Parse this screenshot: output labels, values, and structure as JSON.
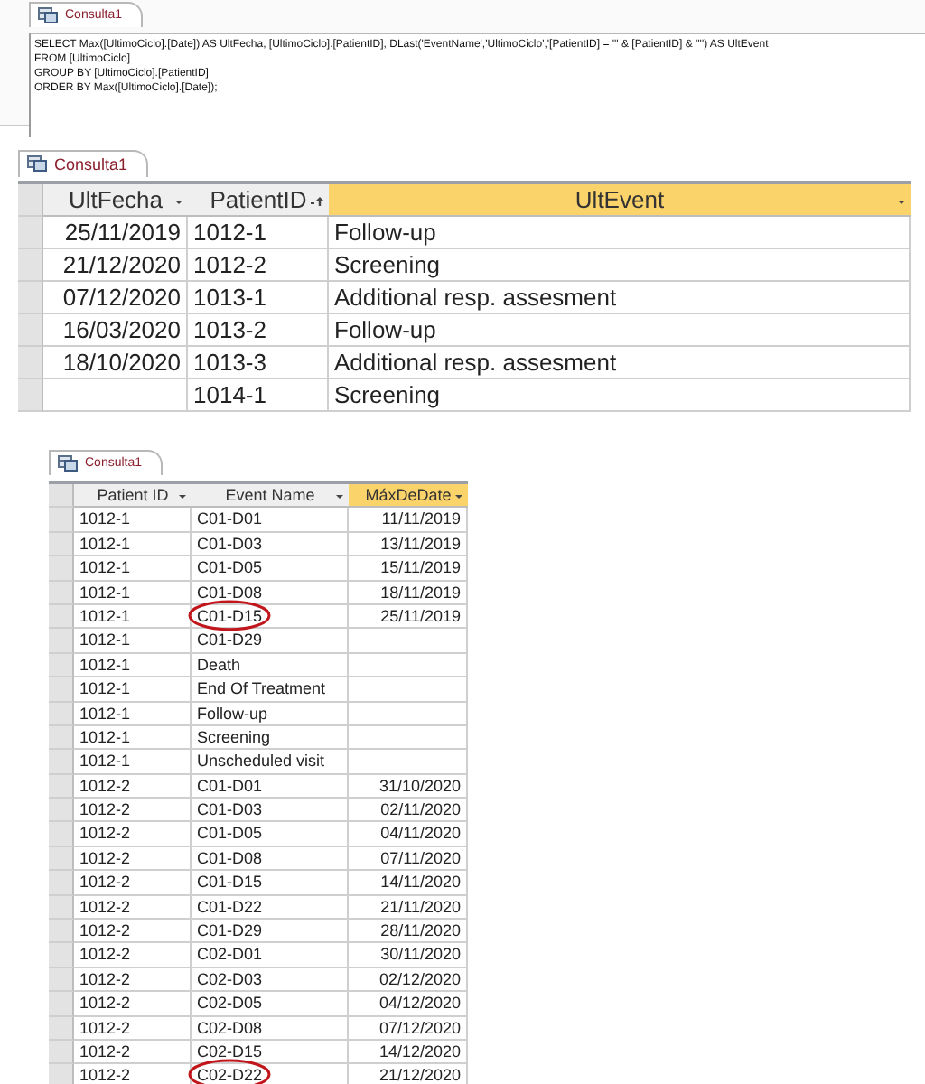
{
  "sql_view": {
    "tab": {
      "label": "Consulta1",
      "selected": true
    },
    "lines": [
      "SELECT Max([UltimoCiclo].[Date]) AS UltFecha, [UltimoCiclo].[PatientID], DLast('EventName','UltimoCiclo','[PatientID] = ''' & [PatientID] & '''') AS UltEvent",
      "FROM [UltimoCiclo]",
      "GROUP BY [UltimoCiclo].[PatientID]",
      "ORDER BY Max([UltimoCiclo].[Date]);"
    ]
  },
  "result_grid": {
    "tab": {
      "label": "Consulta1",
      "selected": true
    },
    "columns": [
      {
        "label": "UltFecha",
        "selected": false,
        "sorted": false
      },
      {
        "label": "PatientID",
        "selected": false,
        "sorted": true
      },
      {
        "label": "UltEvent",
        "selected": true,
        "sorted": false
      }
    ],
    "rows": [
      {
        "cells": [
          "25/11/2019",
          "1012-1",
          "Follow-up"
        ]
      },
      {
        "cells": [
          "21/12/2020",
          "1012-2",
          "Screening"
        ]
      },
      {
        "cells": [
          "07/12/2020",
          "1013-1",
          "Additional resp. assesment"
        ]
      },
      {
        "cells": [
          "16/03/2020",
          "1013-2",
          "Follow-up"
        ]
      },
      {
        "cells": [
          "18/10/2020",
          "1013-3",
          "Additional resp. assesment"
        ]
      },
      {
        "cells": [
          "",
          "1014-1",
          "Screening"
        ]
      }
    ]
  },
  "source_grid": {
    "tab": {
      "label": "Consulta1",
      "selected": true
    },
    "columns": [
      {
        "label": "Patient ID",
        "selected": false,
        "sorted": false
      },
      {
        "label": "Event Name",
        "selected": false,
        "sorted": false
      },
      {
        "label": "MáxDeDate",
        "selected": true,
        "sorted": false
      }
    ],
    "rows": [
      {
        "cells": [
          "1012-1",
          "C01-D01",
          "11/11/2019"
        ],
        "circled": false
      },
      {
        "cells": [
          "1012-1",
          "C01-D03",
          "13/11/2019"
        ],
        "circled": false
      },
      {
        "cells": [
          "1012-1",
          "C01-D05",
          "15/11/2019"
        ],
        "circled": false
      },
      {
        "cells": [
          "1012-1",
          "C01-D08",
          "18/11/2019"
        ],
        "circled": false
      },
      {
        "cells": [
          "1012-1",
          "C01-D15",
          "25/11/2019"
        ],
        "circled": true
      },
      {
        "cells": [
          "1012-1",
          "C01-D29",
          ""
        ],
        "circled": false
      },
      {
        "cells": [
          "1012-1",
          "Death",
          ""
        ],
        "circled": false
      },
      {
        "cells": [
          "1012-1",
          "End Of  Treatment",
          ""
        ],
        "circled": false
      },
      {
        "cells": [
          "1012-1",
          "Follow-up",
          ""
        ],
        "circled": false
      },
      {
        "cells": [
          "1012-1",
          "Screening",
          ""
        ],
        "circled": false
      },
      {
        "cells": [
          "1012-1",
          "Unscheduled visit",
          ""
        ],
        "circled": false
      },
      {
        "cells": [
          "1012-2",
          "C01-D01",
          "31/10/2020"
        ],
        "circled": false
      },
      {
        "cells": [
          "1012-2",
          "C01-D03",
          "02/11/2020"
        ],
        "circled": false
      },
      {
        "cells": [
          "1012-2",
          "C01-D05",
          "04/11/2020"
        ],
        "circled": false
      },
      {
        "cells": [
          "1012-2",
          "C01-D08",
          "07/11/2020"
        ],
        "circled": false
      },
      {
        "cells": [
          "1012-2",
          "C01-D15",
          "14/11/2020"
        ],
        "circled": false
      },
      {
        "cells": [
          "1012-2",
          "C01-D22",
          "21/11/2020"
        ],
        "circled": false
      },
      {
        "cells": [
          "1012-2",
          "C01-D29",
          "28/11/2020"
        ],
        "circled": false
      },
      {
        "cells": [
          "1012-2",
          "C02-D01",
          "30/11/2020"
        ],
        "circled": false
      },
      {
        "cells": [
          "1012-2",
          "C02-D03",
          "02/12/2020"
        ],
        "circled": false
      },
      {
        "cells": [
          "1012-2",
          "C02-D05",
          "04/12/2020"
        ],
        "circled": false
      },
      {
        "cells": [
          "1012-2",
          "C02-D08",
          "07/12/2020"
        ],
        "circled": false
      },
      {
        "cells": [
          "1012-2",
          "C02-D15",
          "14/12/2020"
        ],
        "circled": false
      },
      {
        "cells": [
          "1012-2",
          "C02-D22",
          "21/12/2020"
        ],
        "circled": true
      }
    ]
  }
}
